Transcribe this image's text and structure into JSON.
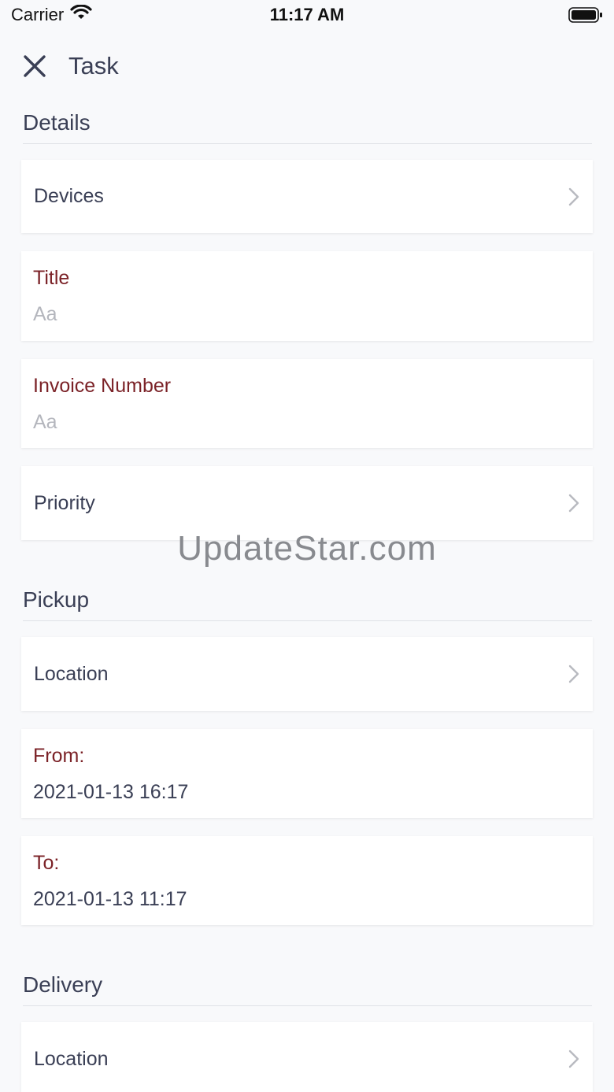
{
  "status_bar": {
    "carrier": "Carrier",
    "time": "11:17 AM"
  },
  "nav": {
    "title": "Task"
  },
  "sections": {
    "details": {
      "header": "Details",
      "devices_label": "Devices",
      "title_label": "Title",
      "title_placeholder": "Aa",
      "invoice_label": "Invoice Number",
      "invoice_placeholder": "Aa",
      "priority_label": "Priority"
    },
    "pickup": {
      "header": "Pickup",
      "location_label": "Location",
      "from_label": "From:",
      "from_value": "2021-01-13 16:17",
      "to_label": "To:",
      "to_value": "2021-01-13 11:17"
    },
    "delivery": {
      "header": "Delivery",
      "location_label": "Location"
    }
  },
  "watermark": "UpdateStar.com",
  "colors": {
    "accent_label": "#7b2227",
    "text": "#3a3f55",
    "placeholder": "#b4b6bd",
    "background": "#f8f9fb"
  }
}
